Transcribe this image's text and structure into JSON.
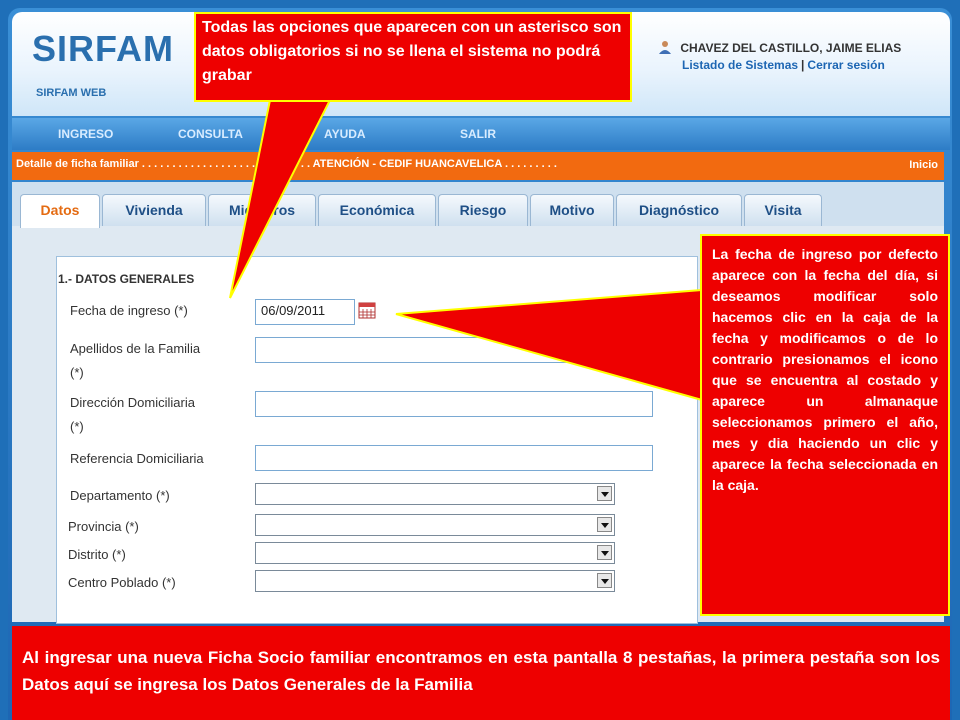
{
  "header": {
    "logo": "SIRFAM",
    "logo_sub": "SIRFAM WEB",
    "user_name": "CHAVEZ DEL CASTILLO, JAIME ELIAS",
    "link_systems": "Listado de Sistemas",
    "link_separator": "|",
    "link_logout": "Cerrar sesión"
  },
  "nav": {
    "items": [
      "INGRESO",
      "CONSULTA",
      "AYUDA",
      "SALIR"
    ]
  },
  "breadcrumb": {
    "text": "Detalle de ficha familiar . . . . . . . . . . . . . . . . . . . . . . . . . . . . ATENCIÓN - CEDIF HUANCAVELICA . . . . . . . . .",
    "home": "Inicio"
  },
  "tabs": [
    "Datos",
    "Vivienda",
    "Miembros",
    "Económica",
    "Riesgo",
    "Motivo",
    "Diagnóstico",
    "Visita"
  ],
  "active_tab": "Datos",
  "form": {
    "section_title": "1.- DATOS GENERALES",
    "fecha_label": "Fecha de ingreso (*)",
    "fecha_value": "06/09/2011",
    "apellidos_label1": "Apellidos de la Familia",
    "apellidos_label2": "(*)",
    "direccion_label1": "Dirección Domiciliaria",
    "direccion_label2": "(*)",
    "referencia_label": "Referencia Domiciliaria",
    "departamento_label": "Departamento (*)",
    "provincia_label": "Provincia (*)",
    "distrito_label": "Distrito (*)",
    "centro_label": "Centro Poblado (*)"
  },
  "callouts": {
    "top": "Todas las opciones que aparecen con un asterisco son datos obligatorios si no se llena el sistema no podrá grabar",
    "right": "La fecha de ingreso por defecto aparece con la fecha del día, si deseamos modificar solo hacemos clic en la caja de la fecha y modificamos o de lo contrario presionamos el icono que se encuentra al costado y aparece un almanaque seleccionamos primero el año, mes y dia haciendo un clic y aparece la fecha seleccionada en la caja.",
    "bottom": "Al ingresar una nueva Ficha Socio familiar encontramos en esta pantalla 8 pestañas, la primera pestaña son los Datos aquí se ingresa los Datos Generales de la Familia"
  },
  "colors": {
    "callout_red": "#ee0000",
    "callout_border": "#ffff00",
    "breadcrumb_orange": "#f26a10",
    "active_tab_text": "#e46b12",
    "brand_blue": "#2a6fae"
  }
}
